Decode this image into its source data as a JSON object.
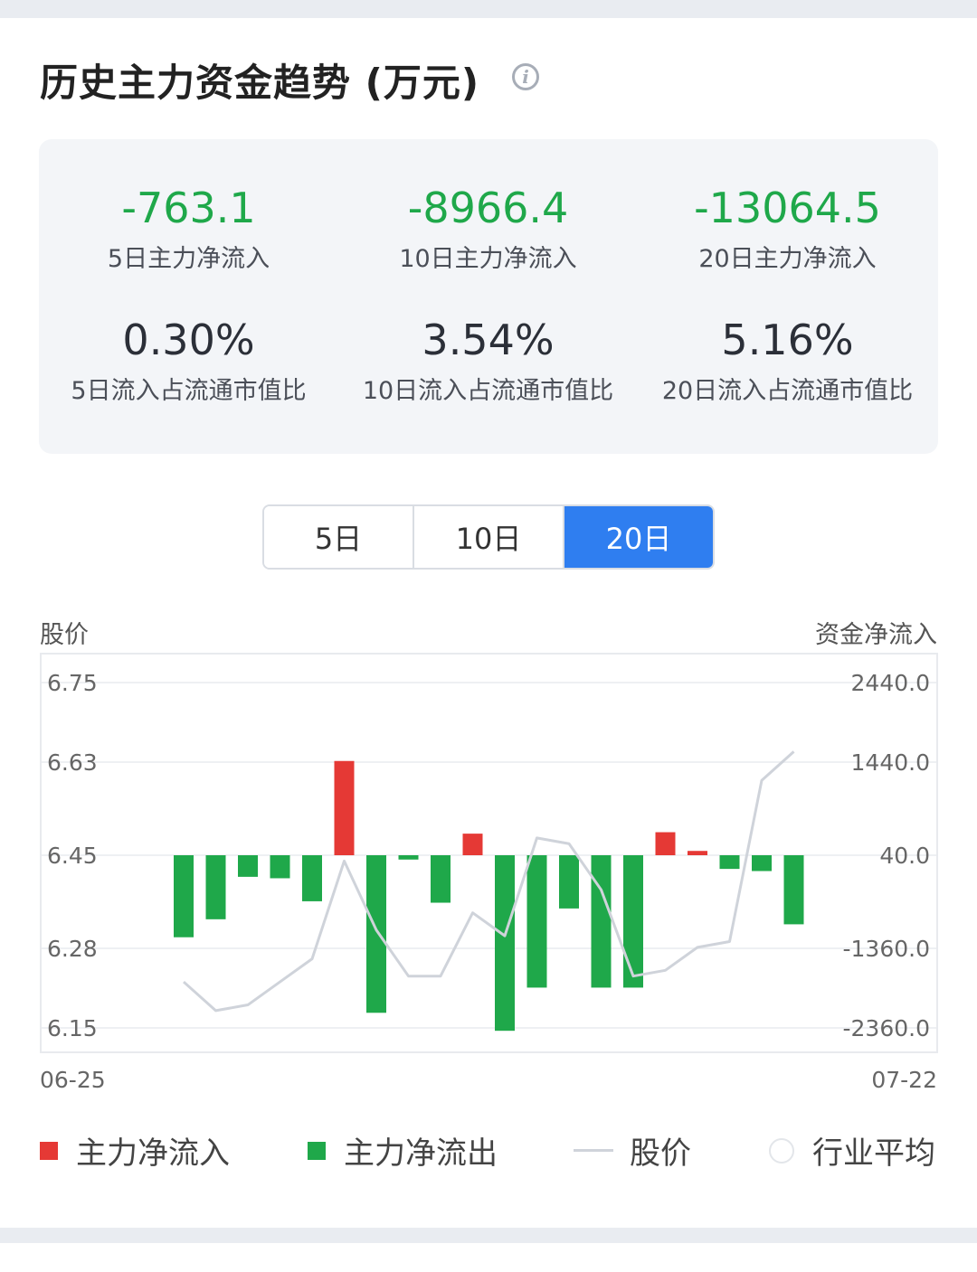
{
  "header": {
    "title": "历史主力资金趋势 (万元)",
    "info_icon": "info-icon"
  },
  "stats": {
    "row1": [
      {
        "value": "-763.1",
        "label": "5日主力净流入",
        "color": "#1fa84a"
      },
      {
        "value": "-8966.4",
        "label": "10日主力净流入",
        "color": "#1fa84a"
      },
      {
        "value": "-13064.5",
        "label": "20日主力净流入",
        "color": "#1fa84a"
      }
    ],
    "row2": [
      {
        "value": "0.30%",
        "label": "5日流入占流通市值比"
      },
      {
        "value": "3.54%",
        "label": "10日流入占流通市值比"
      },
      {
        "value": "5.16%",
        "label": "20日流入占流通市值比"
      }
    ]
  },
  "tabs": {
    "items": [
      "5日",
      "10日",
      "20日"
    ],
    "selected": "20日"
  },
  "chart_labels": {
    "left_title": "股价",
    "right_title": "资金净流入",
    "left_ticks": [
      "6.75",
      "6.63",
      "6.45",
      "6.28",
      "6.15"
    ],
    "right_ticks": [
      "2440.0",
      "1440.0",
      "40.0",
      "-1360.0",
      "-2360.0"
    ],
    "start_date": "06-25",
    "end_date": "07-22"
  },
  "chart_data": {
    "type": "bar",
    "series": [
      {
        "name": "主力净流入/主力净流出",
        "values": [
          -1100,
          -850,
          -260,
          -280,
          -600,
          1350,
          -2150,
          -20,
          -620,
          340,
          -2400,
          -1800,
          -700,
          -1800,
          -1800,
          360,
          100,
          -150,
          -180,
          -920
        ]
      },
      {
        "name": "股价",
        "values": [
          6.23,
          6.18,
          6.19,
          6.23,
          6.27,
          6.44,
          6.32,
          6.24,
          6.24,
          6.35,
          6.31,
          6.48,
          6.47,
          6.39,
          6.24,
          6.25,
          6.29,
          6.3,
          6.58,
          6.63
        ]
      }
    ],
    "left_axis_range": [
      6.15,
      6.75
    ],
    "right_axis_range": [
      -2360,
      2440
    ],
    "colors": {
      "inflow": "#e53935",
      "outflow": "#1fa84a",
      "price": "#cfd3da"
    }
  },
  "legend": [
    {
      "label": "主力净流入",
      "color": "#e53935"
    },
    {
      "label": "主力净流出",
      "color": "#1fa84a"
    },
    {
      "label": "股价",
      "color": "#cfd3da"
    },
    {
      "label": "行业平均",
      "color": "#e3e6ea"
    }
  ]
}
